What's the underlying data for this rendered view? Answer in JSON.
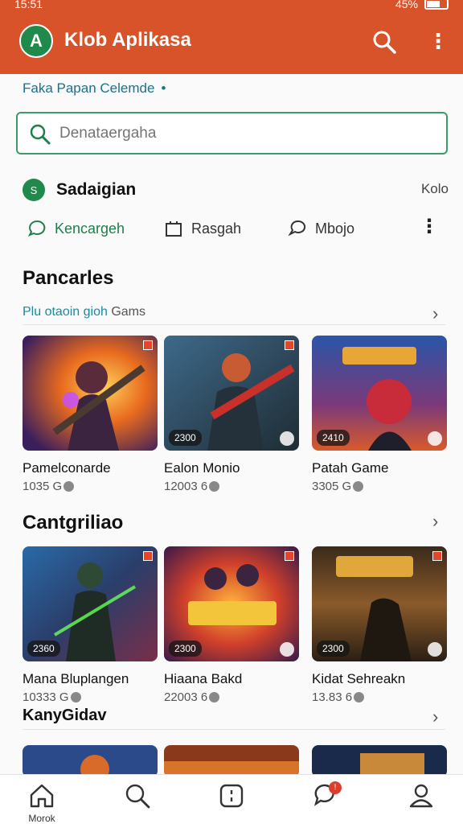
{
  "status": {
    "time": "15:51",
    "battery": "45%"
  },
  "appbar": {
    "logo_letter": "A",
    "title": "Klob Aplikasa"
  },
  "breadcrumb": {
    "text": "Faka Papan Celemde",
    "dot": "•"
  },
  "search": {
    "placeholder": "Denataergaha"
  },
  "section": {
    "badge": "S",
    "title": "Sadaigian",
    "right": "Kolo"
  },
  "tabs": [
    {
      "label": "Kencargeh",
      "icon": "chat-icon"
    },
    {
      "label": "Rasgah",
      "icon": "box-icon"
    },
    {
      "label": "Mbojo",
      "icon": "comment-icon"
    }
  ],
  "popular": {
    "title": "Pancarles",
    "subtitle_colored": "Plu otaoin gioh",
    "subtitle_rest": "Gams",
    "cards": [
      {
        "title": "Pamelconarde",
        "meta": "1035 G",
        "pill": ""
      },
      {
        "title": "Ealon Monio",
        "meta": "12003 6",
        "pill": "2300"
      },
      {
        "title": "Patah Game",
        "meta": "3305 G",
        "pill": "2410"
      }
    ]
  },
  "category": {
    "title": "Cantgriliao",
    "cards": [
      {
        "title": "Mana Bluplangen",
        "meta": "10333 G",
        "pill": "2360"
      },
      {
        "title": "Hiaana Bakd",
        "meta": "22003 6",
        "pill": "2300"
      },
      {
        "title": "Kidat Sehreakn",
        "meta": "13.83 6",
        "pill": "2300"
      }
    ]
  },
  "third": {
    "title": "KanyGidav"
  },
  "bottom_nav": [
    {
      "label": "Morok",
      "icon": "home-icon"
    },
    {
      "label": "",
      "icon": "search-icon"
    },
    {
      "label": "",
      "icon": "apps-icon"
    },
    {
      "label": "",
      "icon": "notifications-icon",
      "badge": "!"
    },
    {
      "label": "",
      "icon": "profile-icon"
    }
  ],
  "colors": {
    "brand": "#d9532a",
    "accent": "#1f8a4c",
    "link": "#1d6f8a"
  }
}
